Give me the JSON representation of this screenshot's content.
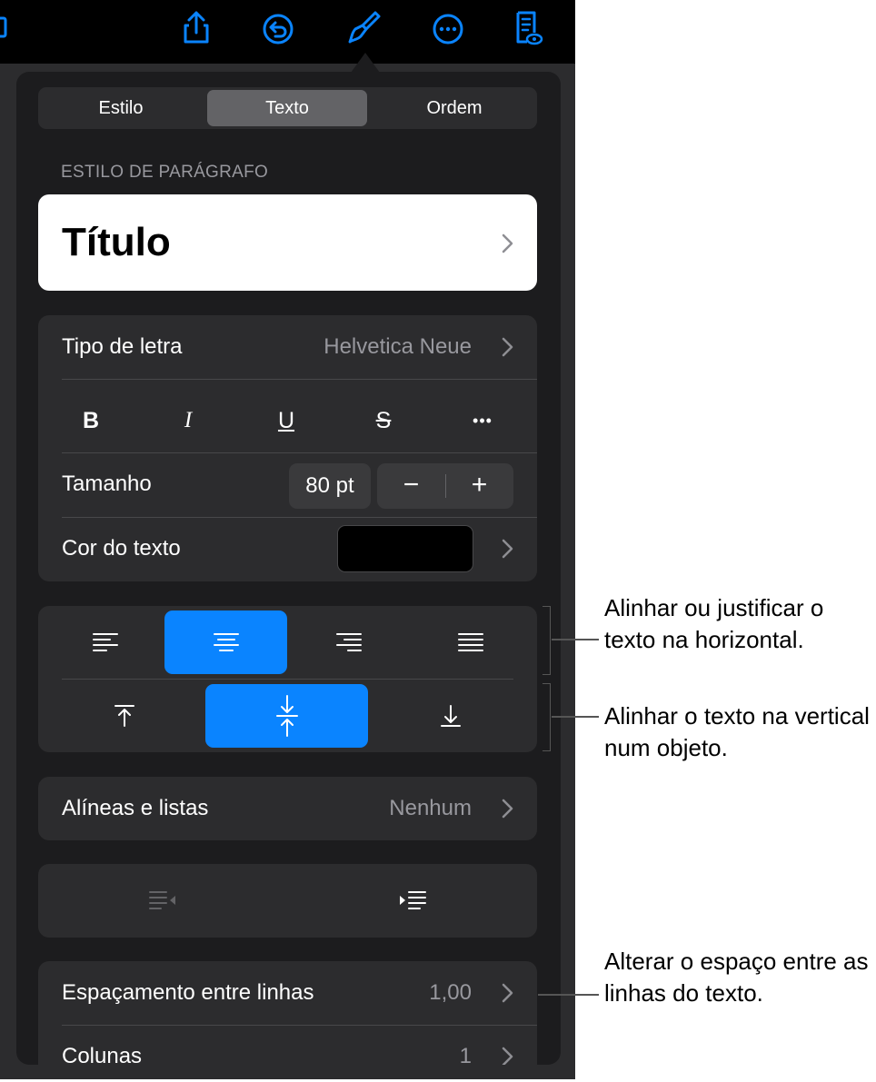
{
  "toolbar": {
    "icons": [
      "share-icon",
      "undo-icon",
      "paintbrush-icon",
      "more-icon",
      "reader-view-icon"
    ]
  },
  "tabs": [
    {
      "label": "Estilo",
      "active": false
    },
    {
      "label": "Texto",
      "active": true
    },
    {
      "label": "Ordem",
      "active": false
    }
  ],
  "paragraph_style": {
    "header": "ESTILO DE PARÁGRAFO",
    "value": "Título"
  },
  "font": {
    "label": "Tipo de letra",
    "value": "Helvetica Neue",
    "styles": [
      "B",
      "I",
      "U",
      "S",
      "•••"
    ]
  },
  "size": {
    "label": "Tamanho",
    "value": "80 pt",
    "minus": "−",
    "plus": "+"
  },
  "text_color": {
    "label": "Cor do texto",
    "color": "#000000"
  },
  "horizontal_alignment": {
    "options": [
      "left",
      "center",
      "right",
      "justify"
    ],
    "selected": "center"
  },
  "vertical_alignment": {
    "options": [
      "top",
      "middle",
      "bottom"
    ],
    "selected": "middle"
  },
  "bullets": {
    "label": "Alíneas e listas",
    "value": "Nenhum"
  },
  "line_spacing": {
    "label": "Espaçamento entre linhas",
    "value": "1,00"
  },
  "columns": {
    "label": "Colunas",
    "value": "1"
  },
  "callouts": {
    "horizontal": "Alinhar ou justificar o texto na horizontal.",
    "vertical": "Alinhar o texto na vertical num objeto.",
    "spacing": "Alterar o espaço entre as linhas do texto."
  },
  "colors": {
    "accent": "#0a84ff",
    "panel": "#2c2c2e",
    "popover": "#1c1c1e"
  }
}
